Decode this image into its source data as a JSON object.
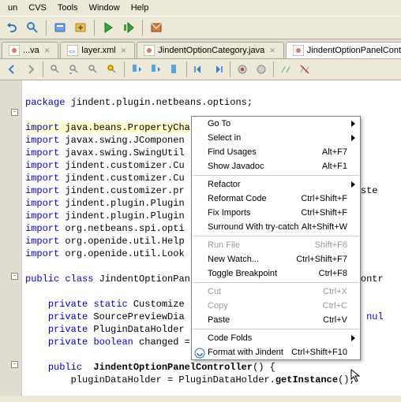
{
  "menubar": [
    "un",
    "CVS",
    "Tools",
    "Window",
    "Help"
  ],
  "tabs": {
    "t0": "...va",
    "t1": "layer.xml",
    "t2": "JindentOptionCategory.java",
    "t3": "JindentOptionPanelController.java"
  },
  "code": {
    "pkg_kw": "package",
    "pkg_name": " jindent.plugin.netbeans.options;",
    "imp_kw": "import",
    "imp1": " java.beans.PropertyCha",
    "imp2": " javax.swing.JComponen",
    "imp3": " javax.swing.SwingUtil",
    "imp4": " jindent.customizer.Cu",
    "imp5": " jindent.customizer.Cu",
    "imp6": " jindent.customizer.pr",
    "imp7": " jindent.plugin.Plugin",
    "imp8": " jindent.plugin.Plugin",
    "imp9": " org.netbeans.spi.opti",
    "imp10": " org.openide.util.Help",
    "imp11": " org.openide.util.Look",
    "imp6_tail": "Liste",
    "pub_kw": "public",
    "cls_kw": "class",
    "cls_name": " JindentOptionPan",
    "cls_tail": "Contr",
    "prv_kw": "private",
    "stat_kw": "static",
    "stat_name": " Customize",
    "fld2": " SourcePreviewDia",
    "fld2_tail": " = nul",
    "fld3": " PluginDataHolder",
    "bool_kw": "boolean",
    "bool_name": " changed =",
    "m_kw": "public",
    "m_name": " JindentOptionPanelController",
    "m_paren": "() {",
    "body": "        pluginDataHolder = PluginDataHolder.",
    "body_call": "getInstance",
    "body_end": "();"
  },
  "context_menu": [
    {
      "label": "Go To",
      "type": "sub"
    },
    {
      "label": "Select in",
      "type": "sub"
    },
    {
      "label": "Find Usages",
      "shortcut": "Alt+F7"
    },
    {
      "label": "Show Javadoc",
      "shortcut": "Alt+F1"
    },
    {
      "type": "sep"
    },
    {
      "label": "Refactor",
      "type": "sub"
    },
    {
      "label": "Reformat Code",
      "shortcut": "Ctrl+Shift+F"
    },
    {
      "label": "Fix Imports",
      "shortcut": "Ctrl+Shift+F"
    },
    {
      "label": "Surround With try-catch",
      "shortcut": "Alt+Shift+W"
    },
    {
      "type": "sep"
    },
    {
      "label": "Run File",
      "shortcut": "Shift+F6",
      "disabled": true
    },
    {
      "label": "New Watch...",
      "shortcut": "Ctrl+Shift+F7"
    },
    {
      "label": "Toggle Breakpoint",
      "shortcut": "Ctrl+F8"
    },
    {
      "type": "sep"
    },
    {
      "label": "Cut",
      "shortcut": "Ctrl+X",
      "disabled": true
    },
    {
      "label": "Copy",
      "shortcut": "Ctrl+C",
      "disabled": true
    },
    {
      "label": "Paste",
      "shortcut": "Ctrl+V"
    },
    {
      "type": "sep"
    },
    {
      "label": "Code Folds",
      "type": "sub"
    },
    {
      "label": "Format with Jindent",
      "shortcut": "Ctrl+Shift+F10",
      "icon": true
    }
  ]
}
